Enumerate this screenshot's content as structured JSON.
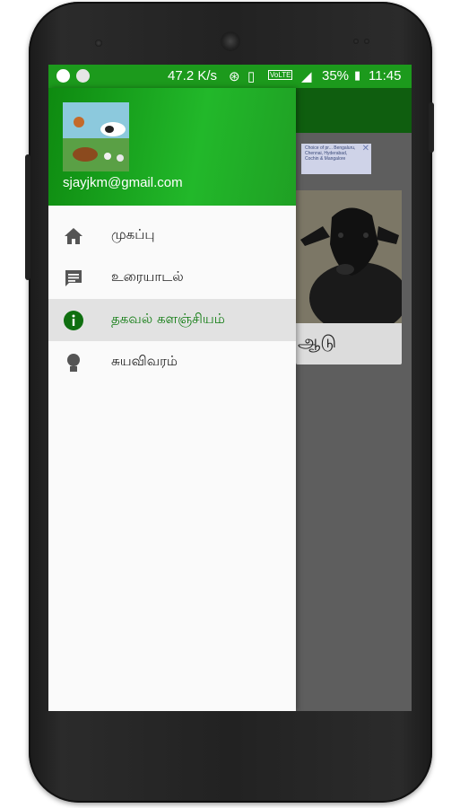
{
  "status_bar": {
    "speed": "47.2 K/s",
    "network": "VoLTE",
    "battery": "35%",
    "time": "11:45"
  },
  "drawer": {
    "email": "sjayjkm@gmail.com",
    "items": [
      {
        "label": "முகப்பு",
        "icon": "home-icon",
        "active": false
      },
      {
        "label": "உரையாடல்",
        "icon": "chat-icon",
        "active": false
      },
      {
        "label": "தகவல் களஞ்சியம்",
        "icon": "info-icon",
        "active": true
      },
      {
        "label": "சுயவிவரம்",
        "icon": "profile-icon",
        "active": false
      }
    ]
  },
  "background": {
    "ad_text": "Choice of pr... Bengaluru, Chennai, Hyderabad, Cochin & Mangalore",
    "card_label": "ஆடு"
  },
  "colors": {
    "accent": "#1c9a1c",
    "app_bar": "#0f5e0f",
    "active_text": "#0f7b10"
  }
}
